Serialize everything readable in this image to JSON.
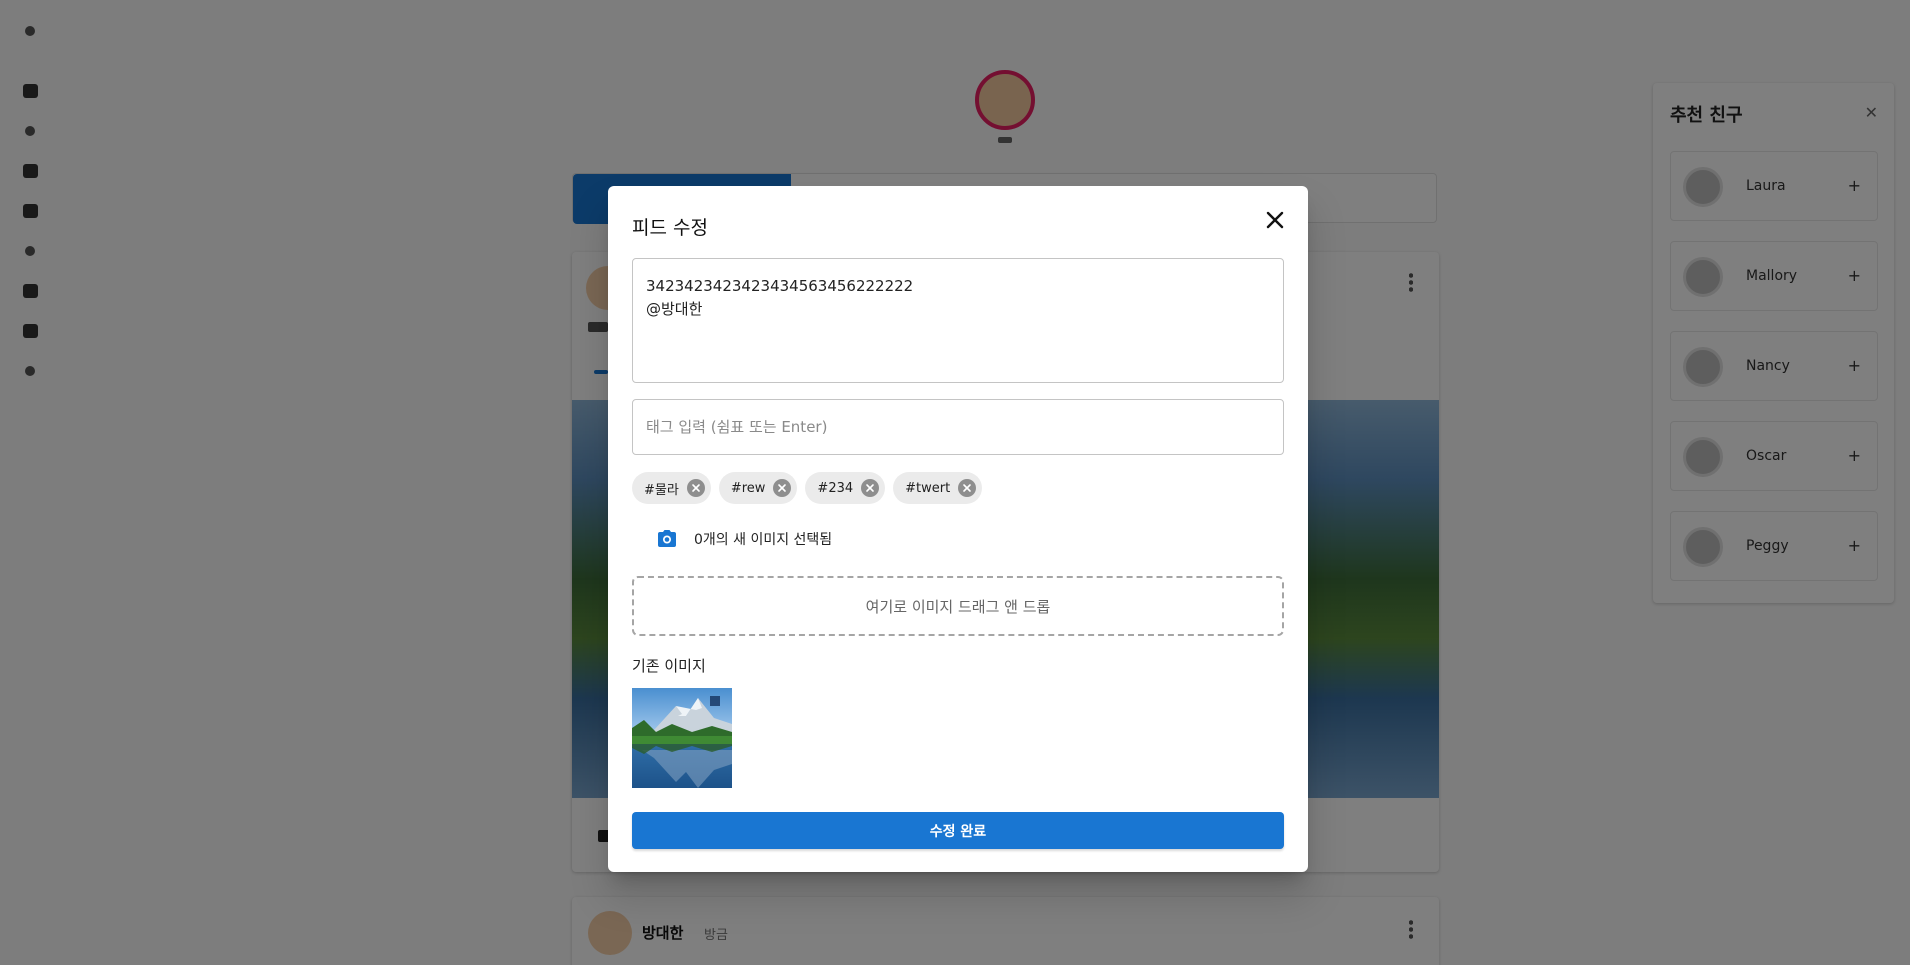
{
  "background": {
    "feed_post_2": {
      "author": "방대한",
      "time": "방금"
    },
    "friends_panel": {
      "title": "추천 친구",
      "friends": [
        "Laura",
        "Mallory",
        "Nancy",
        "Oscar",
        "Peggy"
      ]
    }
  },
  "dialog": {
    "title": "피드 수정",
    "content_lines": [
      "3423423423423434563456222222",
      "@방대한"
    ],
    "tag_input": {
      "placeholder": "태그 입력 (쉼표 또는 Enter)",
      "value": ""
    },
    "tags": [
      "#물라",
      "#rew",
      "#234",
      "#twert"
    ],
    "new_image_status": "0개의 새 이미지 선택됨",
    "dropzone_text": "여기로 이미지 드래그 앤 드롭",
    "existing_images_label": "기존 이미지",
    "existing_images": [
      {
        "icon": "landscape-lake-thumbnail"
      }
    ],
    "submit_label": "수정 완료"
  },
  "colors": {
    "primary": "#1976d2",
    "overlay": "rgba(0,0,0,0.5)",
    "chip_bg": "#ebebeb",
    "story_ring": "#e91e63"
  }
}
